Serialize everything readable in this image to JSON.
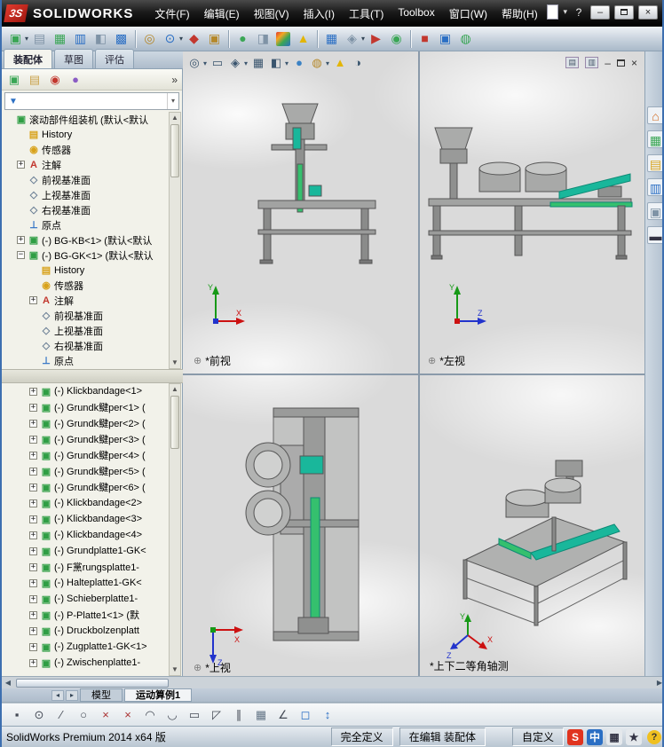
{
  "glyphs": {
    "caret": "▾",
    "min": "–",
    "close": "×",
    "chevron": "»",
    "up": "▲",
    "down": "▼",
    "left": "◀",
    "right": "▶",
    "navleft": "◂",
    "navright": "▸",
    "origin": "⊕",
    "help": "?",
    "funnel": "▼"
  },
  "colors": {
    "axis_x": "#cc1111",
    "axis_y": "#179917",
    "axis_z": "#2233cc",
    "accent_teal": "#19b79b",
    "accent_green": "#35c06e"
  },
  "titlebar": {
    "logo_prefix": "3S",
    "logo_text": "SOLIDWORKS",
    "menus": [
      "文件(F)",
      "编辑(E)",
      "视图(V)",
      "插入(I)",
      "工具(T)",
      "Toolbox",
      "窗口(W)",
      "帮助(H)"
    ]
  },
  "toolbar_main": {
    "icons": [
      {
        "g": "▣",
        "c": "#3aa655"
      },
      {
        "g": "▤",
        "c": "#7f93a6"
      },
      {
        "g": "▦",
        "c": "#3aa655"
      },
      {
        "g": "▥",
        "c": "#2b6fc4"
      },
      {
        "g": "◧",
        "c": "#7f93a6"
      },
      {
        "g": "▩",
        "c": "#2b6fc4"
      },
      {
        "g": "◎",
        "c": "#b5882a"
      },
      {
        "g": "⊙",
        "c": "#2b6fc4"
      },
      {
        "g": "◆",
        "c": "#c2372e"
      },
      {
        "g": "▣",
        "c": "#b5882a"
      },
      {
        "g": "●",
        "c": "#3aa655"
      },
      {
        "g": "◨",
        "c": "#7f93a6"
      },
      {
        "g": "",
        "c": "",
        "css": "background:linear-gradient(135deg,#e23a2e,#f5a623 30%,#3aa655 60%,#2b6fc4);width:16px;height:16px;margin:2px 3px;"
      },
      {
        "g": "▲",
        "c": "#e3b505"
      },
      {
        "g": "▦",
        "c": "#2b6fc4"
      },
      {
        "g": "◈",
        "c": "#7f93a6"
      },
      {
        "g": "▶",
        "c": "#c2372e"
      },
      {
        "g": "◉",
        "c": "#3aa655"
      },
      {
        "g": "■",
        "c": "#c2372e"
      },
      {
        "g": "▣",
        "c": "#2b6fc4"
      },
      {
        "g": "◍",
        "c": "#3aa655"
      }
    ]
  },
  "panel_tabs": [
    "装配体",
    "草图",
    "评估"
  ],
  "manager": {
    "icons": [
      {
        "g": "▣",
        "c": "#3aa655"
      },
      {
        "g": "▤",
        "c": "#c9a24a"
      },
      {
        "g": "◉",
        "c": "#c2372e"
      },
      {
        "g": "●",
        "c": "#8a5cc4"
      }
    ]
  },
  "tree": {
    "items": [
      {
        "e": "",
        "g": "▣",
        "c": "#2f9e44",
        "label": "滚动部件组装机 (默认<默认"
      },
      {
        "e": "",
        "g": "▤",
        "c": "#d8a21a",
        "label": "History"
      },
      {
        "e": "",
        "g": "◉",
        "c": "#d8a21a",
        "label": "传感器"
      },
      {
        "e": "+",
        "g": "A",
        "c": "#c2372e",
        "label": "注解"
      },
      {
        "e": "",
        "g": "◇",
        "c": "#6b7f95",
        "label": "前视基准面"
      },
      {
        "e": "",
        "g": "◇",
        "c": "#6b7f95",
        "label": "上视基准面"
      },
      {
        "e": "",
        "g": "◇",
        "c": "#6b7f95",
        "label": "右视基准面"
      },
      {
        "e": "",
        "g": "⊥",
        "c": "#2b6fc4",
        "label": "原点"
      },
      {
        "e": "+",
        "g": "▣",
        "c": "#2f9e44",
        "label": "(-) BG-KB<1> (默认<默认"
      },
      {
        "e": "−",
        "g": "▣",
        "c": "#2f9e44",
        "label": "(-) BG-GK<1> (默认<默认"
      },
      {
        "e": "",
        "g": "▤",
        "c": "#d8a21a",
        "label": "History"
      },
      {
        "e": "",
        "g": "◉",
        "c": "#d8a21a",
        "label": "传感器"
      },
      {
        "e": "+",
        "g": "A",
        "c": "#c2372e",
        "label": "注解"
      },
      {
        "e": "",
        "g": "◇",
        "c": "#6b7f95",
        "label": "前视基准面"
      },
      {
        "e": "",
        "g": "◇",
        "c": "#6b7f95",
        "label": "上视基准面"
      },
      {
        "e": "",
        "g": "◇",
        "c": "#6b7f95",
        "label": "右视基准面"
      },
      {
        "e": "",
        "g": "⊥",
        "c": "#2b6fc4",
        "label": "原点"
      },
      {
        "e": "+",
        "g": "▣",
        "c": "#2f9e44",
        "label": "(-) Klickbandage<1>"
      },
      {
        "e": "+",
        "g": "▣",
        "c": "#2f9e44",
        "label": "(-) Grundk鰎per<1> ("
      },
      {
        "e": "+",
        "g": "▣",
        "c": "#2f9e44",
        "label": "(-) Grundk鰎per<2> ("
      },
      {
        "e": "+",
        "g": "▣",
        "c": "#2f9e44",
        "label": "(-) Grundk鰎per<3> ("
      },
      {
        "e": "+",
        "g": "▣",
        "c": "#2f9e44",
        "label": "(-) Grundk鰎per<4> ("
      },
      {
        "e": "+",
        "g": "▣",
        "c": "#2f9e44",
        "label": "(-) Grundk鰎per<5> ("
      },
      {
        "e": "+",
        "g": "▣",
        "c": "#2f9e44",
        "label": "(-) Grundk鰎per<6> ("
      },
      {
        "e": "+",
        "g": "▣",
        "c": "#2f9e44",
        "label": "(-) Klickbandage<2>"
      },
      {
        "e": "+",
        "g": "▣",
        "c": "#2f9e44",
        "label": "(-) Klickbandage<3>"
      },
      {
        "e": "+",
        "g": "▣",
        "c": "#2f9e44",
        "label": "(-) Klickbandage<4>"
      },
      {
        "e": "+",
        "g": "▣",
        "c": "#2f9e44",
        "label": "(-) Grundplatte1-GK<"
      },
      {
        "e": "+",
        "g": "▣",
        "c": "#2f9e44",
        "label": "(-) F黨rungsplatte1-"
      },
      {
        "e": "+",
        "g": "▣",
        "c": "#2f9e44",
        "label": "(-) Halteplatte1-GK<"
      },
      {
        "e": "+",
        "g": "▣",
        "c": "#2f9e44",
        "label": "(-) Schieberplatte1-"
      },
      {
        "e": "+",
        "g": "▣",
        "c": "#2f9e44",
        "label": "(-) P-Platte1<1> (默"
      },
      {
        "e": "+",
        "g": "▣",
        "c": "#2f9e44",
        "label": "(-) Druckbolzenplatt"
      },
      {
        "e": "+",
        "g": "▣",
        "c": "#2f9e44",
        "label": "(-) Zugplatte1-GK<1>"
      },
      {
        "e": "+",
        "g": "▣",
        "c": "#2f9e44",
        "label": "(-) Zwischenplatte1-"
      }
    ]
  },
  "hud": {
    "icons": [
      {
        "g": "◎",
        "c": "#3a556e"
      },
      {
        "g": "▭",
        "c": "#3a556e"
      },
      {
        "g": "◈",
        "c": "#3a556e"
      },
      {
        "g": "▦",
        "c": "#3a556e"
      },
      {
        "g": "◧",
        "c": "#3a556e"
      },
      {
        "g": "●",
        "c": "#3b82c4"
      },
      {
        "g": "◍",
        "c": "#b5882a"
      },
      {
        "g": "▲",
        "c": "#e3b505"
      },
      {
        "g": "◑",
        "c": "#3a556e"
      }
    ]
  },
  "viewport": {
    "ctl": {
      "a": "▤",
      "b": "▥"
    },
    "views": [
      {
        "label": "*前视",
        "triad": {
          "v": "Y",
          "h": "X"
        }
      },
      {
        "label": "*左视",
        "triad": {
          "v": "Y",
          "h": "Z"
        }
      },
      {
        "label": "*上视",
        "triad": {
          "h": "X",
          "d": "Z"
        }
      },
      {
        "label": "*上下二等角轴测",
        "triad": {
          "v": "Y",
          "r": "X",
          "l": "Z"
        }
      }
    ]
  },
  "right_rail": {
    "icons": [
      {
        "g": "⌂",
        "c": "#d2691e"
      },
      {
        "g": "▦",
        "c": "#3aa655"
      },
      {
        "g": "▤",
        "c": "#d8a21a"
      },
      {
        "g": "▥",
        "c": "#2b6fc4"
      },
      {
        "g": "▣",
        "c": "#7f93a6"
      },
      {
        "g": "▬",
        "c": "#333344"
      }
    ]
  },
  "bottom_tabs": {
    "items": [
      "模型",
      "运动算例1"
    ]
  },
  "sketchbar": {
    "icons": [
      {
        "g": "▪",
        "c": "#444a55"
      },
      {
        "g": "⊙",
        "c": "#444a55"
      },
      {
        "g": "∕",
        "c": "#444a55"
      },
      {
        "g": "○",
        "c": "#444a55"
      },
      {
        "g": "×",
        "c": "#aa3333"
      },
      {
        "g": "×",
        "c": "#aa3333"
      },
      {
        "g": "◠",
        "c": "#444a55"
      },
      {
        "g": "◡",
        "c": "#444a55"
      },
      {
        "g": "▭",
        "c": "#444a55"
      },
      {
        "g": "◸",
        "c": "#444a55"
      },
      {
        "g": "∥",
        "c": "#444a55"
      },
      {
        "g": "▦",
        "c": "#667788"
      },
      {
        "g": "∠",
        "c": "#444a55"
      },
      {
        "g": "◻",
        "c": "#2b6fc4"
      },
      {
        "g": "↕",
        "c": "#2b6fc4"
      }
    ]
  },
  "statusbar": {
    "left": "SolidWorks Premium 2014 x64 版",
    "items": [
      "完全定义",
      "在编辑 装配体",
      "自定义"
    ],
    "ime": [
      {
        "g": "S",
        "css": "color:#fff;background:#e0341f"
      },
      {
        "g": "中",
        "css": "color:#fff;background:#2b6fc4"
      },
      {
        "g": "▦",
        "css": "color:#334;background:#e4e8ec"
      },
      {
        "g": "★",
        "css": "color:#334;background:#e4e8ec"
      }
    ]
  }
}
